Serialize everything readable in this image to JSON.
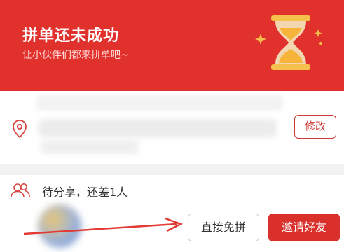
{
  "banner": {
    "title": "拼单还未成功",
    "subtitle": "让小伙伴们都来拼单吧~",
    "icon": "hourglass-icon"
  },
  "address": {
    "edit_label": "修改",
    "icon": "location-pin-icon"
  },
  "group": {
    "status_text": "待分享，还差1人",
    "icon": "people-icon",
    "free_button_label": "直接免拼",
    "invite_button_label": "邀请好友"
  },
  "colors": {
    "brand_red": "#e0312c",
    "button_red": "#d9302b",
    "banner_sub": "#ffd9d6",
    "hourglass_gold": "#f6c04d"
  }
}
